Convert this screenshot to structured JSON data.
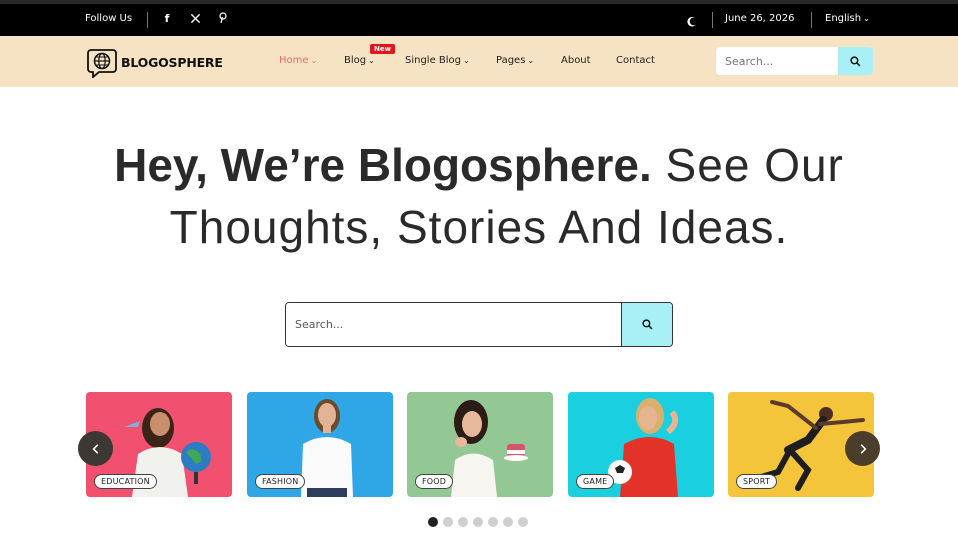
{
  "topbar": {
    "follow_label": "Follow Us",
    "social": [
      {
        "icon": "facebook-icon",
        "glyph": "f"
      },
      {
        "icon": "x-twitter-icon",
        "glyph": "𝕏"
      },
      {
        "icon": "pinterest-icon",
        "glyph": "℗"
      }
    ],
    "date": "June 26, 2026",
    "language": "English"
  },
  "header": {
    "logo_text": "BLOGOSPHERE",
    "nav": [
      {
        "label": "Home",
        "active": true,
        "dropdown": true
      },
      {
        "label": "Blog",
        "active": false,
        "dropdown": true,
        "badge": "New"
      },
      {
        "label": "Single Blog",
        "active": false,
        "dropdown": true
      },
      {
        "label": "Pages",
        "active": false,
        "dropdown": true
      },
      {
        "label": "About",
        "active": false,
        "dropdown": false
      },
      {
        "label": "Contact",
        "active": false,
        "dropdown": false
      }
    ],
    "search_placeholder": "Search..."
  },
  "hero": {
    "bold_text": "Hey, We’re Blogosphere.",
    "light_text_1": " See Our",
    "light_text_2": "Thoughts, Stories And Ideas."
  },
  "main_search": {
    "placeholder": "Search..."
  },
  "categories": [
    {
      "label": "EDUCATION",
      "bg": "#f2506f"
    },
    {
      "label": "FASHION",
      "bg": "#2fa7e6"
    },
    {
      "label": "FOOD",
      "bg": "#93c894"
    },
    {
      "label": "GAME",
      "bg": "#19cfe0"
    },
    {
      "label": "SPORT",
      "bg": "#f4c53b"
    }
  ],
  "slider": {
    "dot_count": 7,
    "active_dot": 0
  },
  "colors": {
    "accent": "#ef6b5b",
    "header_bg": "#f5e3c3",
    "search_btn": "#a9f0f6",
    "badge": "#e8121b"
  }
}
